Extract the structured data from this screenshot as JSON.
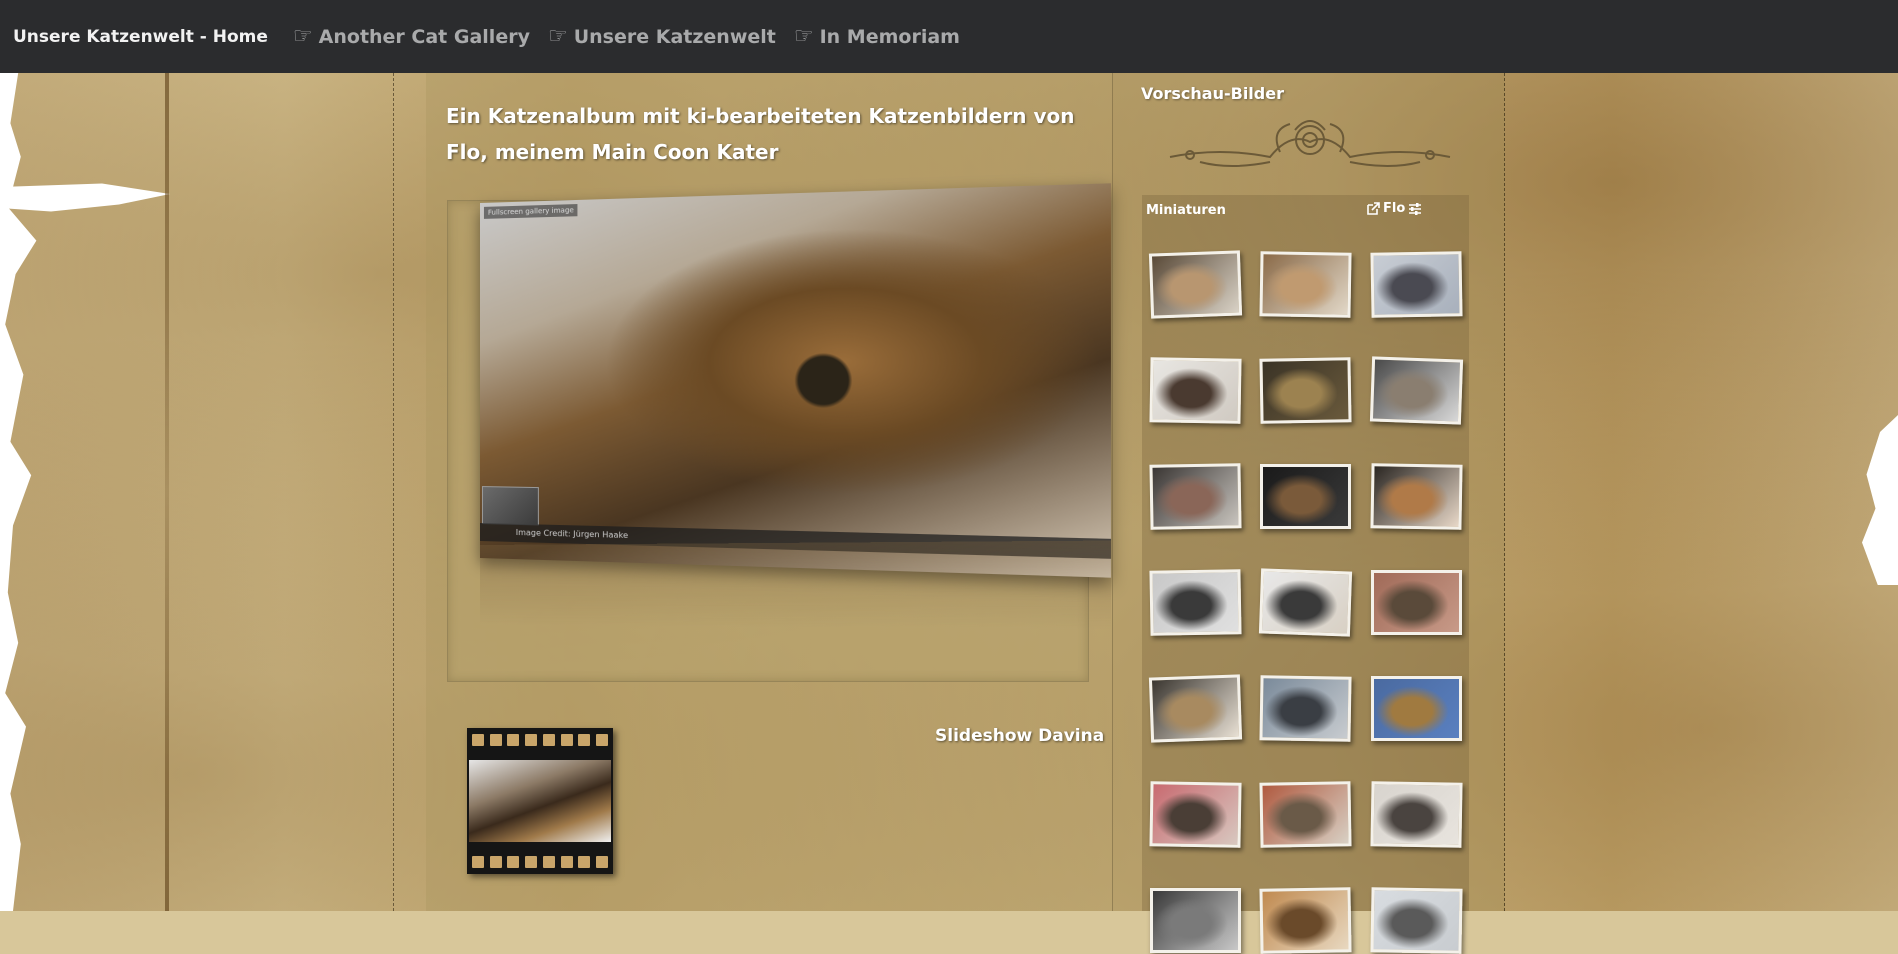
{
  "nav": {
    "brand": "Unsere Katzenwelt - Home",
    "links": [
      {
        "label": "Another Cat Gallery"
      },
      {
        "label": "Unsere Katzenwelt"
      },
      {
        "label": "In Memoriam"
      }
    ]
  },
  "main": {
    "heading": "Ein Katzenalbum mit ki-bearbeiteten Katzenbildern von Flo, meinem Main Coon Kater",
    "photo_badge": "Fullscreen gallery image",
    "photo_caption": "Image Credit: Jürgen Haake",
    "slideshow_label": "Slideshow Davina"
  },
  "sidebar": {
    "title": "Vorschau-Bilder",
    "panel_header": "Miniaturen",
    "panel_user": "Flo",
    "thumbnails": [
      {
        "colors": [
          "#5a4a38",
          "#b89670",
          "#d9d2c6"
        ]
      },
      {
        "colors": [
          "#8a6a48",
          "#c09a70",
          "#e2d8c8"
        ]
      },
      {
        "colors": [
          "#c8cdd4",
          "#4a4a52",
          "#a8b0bc"
        ]
      },
      {
        "colors": [
          "#e8e6e2",
          "#4a3a30",
          "#d0cac2"
        ]
      },
      {
        "colors": [
          "#3a3326",
          "#9c8250",
          "#6a5a3c"
        ]
      },
      {
        "colors": [
          "#4a4a4a",
          "#8a7e70",
          "#d8d8d8"
        ]
      },
      {
        "colors": [
          "#3a3634",
          "#8a6658",
          "#c8c4be"
        ]
      },
      {
        "colors": [
          "#1a1a1a",
          "#7a5a3a",
          "#3a3a3a"
        ]
      },
      {
        "colors": [
          "#2a2622",
          "#b07a48",
          "#e8d8c8"
        ]
      },
      {
        "colors": [
          "#c8c8c8",
          "#3a3a3a",
          "#e0e0e0"
        ]
      },
      {
        "colors": [
          "#e8e8e8",
          "#3a3a3a",
          "#d8d0c4"
        ]
      },
      {
        "colors": [
          "#a06a58",
          "#5a4a3a",
          "#c89a88"
        ]
      },
      {
        "colors": [
          "#3a3630",
          "#a88a60",
          "#e8e0d4"
        ]
      },
      {
        "colors": [
          "#7a8a9a",
          "#3a3e44",
          "#c8ccd0"
        ]
      },
      {
        "colors": [
          "#4a6aa0",
          "#a07a40",
          "#5a80c0"
        ]
      },
      {
        "colors": [
          "#c86a70",
          "#4a3e36",
          "#d8c8c0"
        ]
      },
      {
        "colors": [
          "#b05a40",
          "#6a5a48",
          "#d8d0c4"
        ]
      },
      {
        "colors": [
          "#d8d4ce",
          "#4a4440",
          "#e8e4de"
        ]
      },
      {
        "colors": [
          "#3a3a3a",
          "#7a7a7a",
          "#c8c8c8"
        ]
      },
      {
        "colors": [
          "#c08a50",
          "#6a4a2a",
          "#e8d8c0"
        ]
      },
      {
        "colors": [
          "#d8dce0",
          "#5a5a5a",
          "#c8ccd0"
        ]
      }
    ]
  }
}
